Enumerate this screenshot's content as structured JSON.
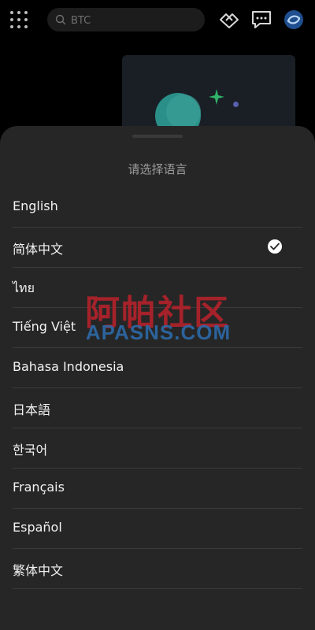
{
  "topbar": {
    "search": {
      "placeholder": "BTC"
    },
    "icons": [
      "apps-grid-icon",
      "search-icon",
      "handshake-icon",
      "chat-icon",
      "avatar-icon"
    ]
  },
  "colors": {
    "sheet_bg": "#262626",
    "divider": "#3a3a3a",
    "title_text": "#9c9c9c",
    "item_text": "#f2f2f2",
    "watermark_red": "#b3222b",
    "watermark_blue": "#2d6aa8",
    "accent_teal": "#2a8f88",
    "accent_green": "#2fb56b"
  },
  "sheet": {
    "title": "请选择语言",
    "items": [
      {
        "label": "English",
        "selected": false
      },
      {
        "label": "简体中文",
        "selected": true
      },
      {
        "label": "ไทย",
        "selected": false
      },
      {
        "label": "Tiếng Việt",
        "selected": false
      },
      {
        "label": "Bahasa Indonesia",
        "selected": false
      },
      {
        "label": "日本語",
        "selected": false
      },
      {
        "label": "한국어",
        "selected": false
      },
      {
        "label": "Français",
        "selected": false
      },
      {
        "label": "Español",
        "selected": false
      },
      {
        "label": "繁体中文",
        "selected": false
      }
    ]
  },
  "watermark": {
    "chinese": "阿帕社区",
    "english": "APASNS.COM"
  }
}
